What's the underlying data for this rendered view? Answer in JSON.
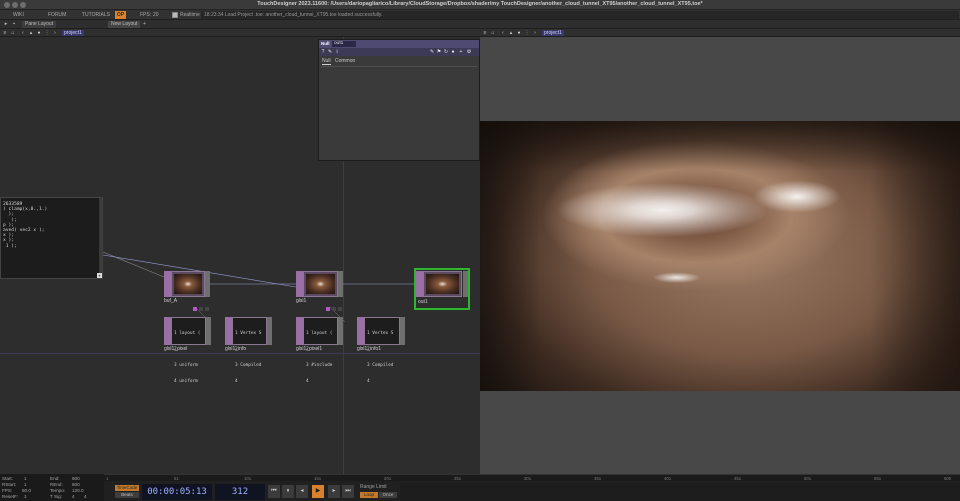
{
  "window": {
    "title": "TouchDesigner 2023.11600: /Users/dariopagliarico/Library/CloudStorage/Dropbox/shader/my TouchDesigner/another_cloud_tunnel_XT95/another_cloud_tunnel_XT95.toe*"
  },
  "menubar": {
    "wiki": "WIKI",
    "forum": "FORUM",
    "tutorials": "TUTORIALS",
    "op_badge": "OP",
    "fps_label": "FPS:",
    "fps_value": "20",
    "realtime": "Realtime",
    "status": "18:23:34 Load Project .toe: another_cloud_tunnel_XT95.toe loaded successfully."
  },
  "panebar": {
    "pane_tab": "Pane Layout",
    "new_layout": "New Layout",
    "plus": "+"
  },
  "network": {
    "path": "project1",
    "textport_lines": [
      "2633589",
      ") clamp(x,0.,1.)",
      "  );",
      "   );",
      "p );",
      "aved( vec2 x );",
      "x );",
      "x );",
      " 1 );"
    ],
    "nodes": {
      "buf_a": "buf_A",
      "glsl1": "glsl1",
      "out1": "out1",
      "glsl1_pixel_left": "glsl1_pixel",
      "glsl1_info_left": "glsl1_info",
      "glsl1_pixel_right": "glsl1_pixel1",
      "glsl1_info_right": "glsl1_info1"
    },
    "dat_pixel_lines": [
      "1 layout (",
      "2",
      "3 uniform",
      "4 uniform"
    ],
    "dat_info_lines": [
      "1 Vertex S",
      "2",
      "3 Compiled",
      "4"
    ],
    "dat_pixel2_lines": [
      "1 layout (",
      "2",
      "3 #include",
      "4"
    ],
    "dat_info2_lines": [
      "1 Vertex S",
      "2",
      "3 Compiled",
      "4"
    ]
  },
  "params": {
    "op_type": "Null",
    "op_name": "out1",
    "tab_null": "Null",
    "tab_common": "Common"
  },
  "viewer": {
    "path": "project1"
  },
  "timeline": {
    "ruler_ticks": [
      "1",
      "51",
      "101",
      "151",
      "201",
      "251",
      "301",
      "351",
      "401",
      "451",
      "501",
      "551",
      "600"
    ],
    "stats": {
      "start_label": "Start:",
      "start_val": "1",
      "end_label": "End:",
      "end_val": "600",
      "rstart_label": "RStart:",
      "rstart_val": "1",
      "rend_label": "REnd:",
      "rend_val": "600",
      "fps_label": "FPS:",
      "fps_val": "60.0",
      "tempo_label": "Tempo:",
      "tempo_val": "120.0",
      "reset_label": "ResetF:",
      "reset_val": "1",
      "tsig_label": "T Sig:",
      "tsig_a": "4",
      "tsig_b": "4"
    },
    "timecode_btn": "TimeCode",
    "beats_btn": "Beats",
    "timecode": "00:00:05:13",
    "frame": "312",
    "range_limit": "Range Limit",
    "loop": "Loop",
    "once": "Once"
  }
}
